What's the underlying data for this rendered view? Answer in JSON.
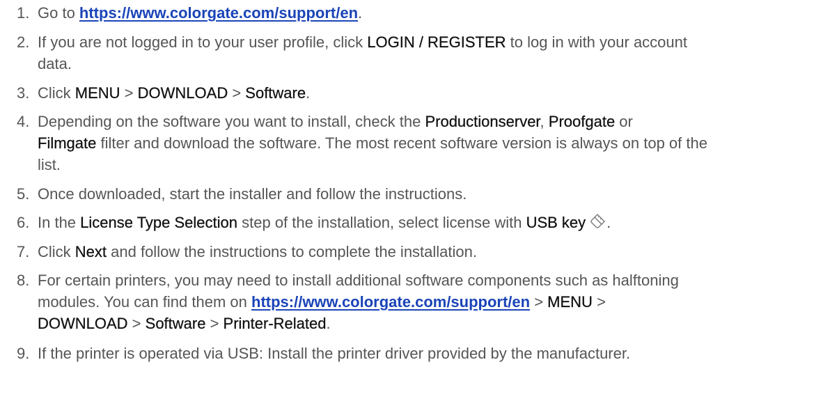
{
  "steps": [
    {
      "num": "1.",
      "pre": "Go to ",
      "link": "https://www.colorgate.com/support/en",
      "post": "."
    },
    {
      "num": "2.",
      "pre": "If you are not logged in to your user profile, click ",
      "b1": "LOGIN / REGISTER",
      "post": " to log in with your account",
      "line2": "data."
    },
    {
      "num": "3.",
      "pre": "Click ",
      "b1": "MENU",
      "sep1": " > ",
      "b2": "DOWNLOAD",
      "sep2": " > ",
      "b3": "Software",
      "post": "."
    },
    {
      "num": "4.",
      "pre": "Depending on the software you want to install, check the ",
      "b1": "Productionserver",
      "sep1": ", ",
      "b2": "Proofgate",
      "sep2": " or",
      "l2b": "Filmgate",
      "l2": " filter and download the software. The most recent software version is always on top of the",
      "line3": "list."
    },
    {
      "num": "5.",
      "text": "Once downloaded, start the installer and follow the instructions."
    },
    {
      "num": "6.",
      "pre": "In the ",
      "b1": "License Type Selection",
      "mid": " step of the installation, select license with ",
      "b2": "USB key",
      "icon": "usb-key-icon",
      "post": "."
    },
    {
      "num": "7.",
      "pre": "Click ",
      "b1": "Next",
      "post": " and follow the instructions to complete the installation."
    },
    {
      "num": "8.",
      "l1": "For certain printers, you may need to install additional software components such as halftoning",
      "l2pre": "modules. You can find them on ",
      "link": "https://www.colorgate.com/support/en",
      "sep1": " > ",
      "b1": "MENU",
      "sep2": " >",
      "b2": "DOWNLOAD",
      "sep3": " > ",
      "b3": "Software",
      "sep4": " > ",
      "b4": "Printer-Related",
      "post": "."
    },
    {
      "num": "9.",
      "text": "If the printer is operated via USB: Install the printer driver provided by the manufacturer."
    }
  ]
}
